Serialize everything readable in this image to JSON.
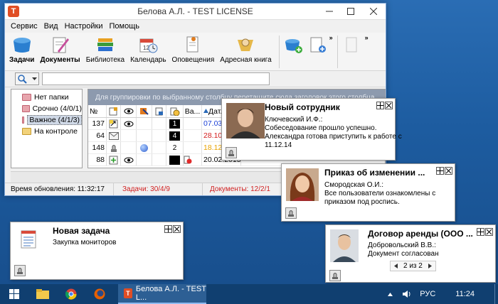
{
  "window": {
    "title": "Белова А.Л. - TEST LICENSE",
    "app_icon": "T",
    "controls": [
      "minimize-icon",
      "maximize-icon",
      "close-icon"
    ]
  },
  "menu": [
    "Сервис",
    "Вид",
    "Настройки",
    "Помощь"
  ],
  "toolbar": {
    "buttons": [
      {
        "label": "Задачи",
        "icon": "tasks-icon"
      },
      {
        "label": "Документы",
        "icon": "documents-icon"
      },
      {
        "label": "Библиотека",
        "icon": "library-icon"
      },
      {
        "label": "Календарь",
        "icon": "calendar-icon"
      },
      {
        "label": "Оповещения",
        "icon": "notifications-icon"
      },
      {
        "label": "Адресная книга",
        "icon": "address-book-icon"
      }
    ],
    "more": "»",
    "calendar_day": "12"
  },
  "search": {
    "value": "",
    "icon": "search-icon"
  },
  "folders": [
    {
      "label": "Нет папки",
      "color": "red"
    },
    {
      "label": "Срочно (4/0/1)",
      "color": "red"
    },
    {
      "label": "Важное (4/1/3)",
      "color": "red",
      "selected": true
    },
    {
      "label": "На контроле",
      "color": "yellow"
    }
  ],
  "grid": {
    "group_hint": "Для группировки по выбранному столбцу перетащите сюда заголовок этого столбца",
    "headers": {
      "num": "№",
      "v": "Ва...",
      "date": "Дат..."
    },
    "rows": [
      {
        "num": "137",
        "count": "1",
        "count_style": "black",
        "date": "07.03.2014",
        "date_color": "#1a3fd6",
        "eye": true
      },
      {
        "num": "64",
        "count": "4",
        "count_style": "black",
        "date": "28.10.2014",
        "date_color": "#d41c1c",
        "eye": false
      },
      {
        "num": "148",
        "count": "2",
        "count_style": "white",
        "date": "18.12.2014",
        "date_color": "#e8a200",
        "eye": false
      },
      {
        "num": "88",
        "count": "",
        "count_style": "black",
        "date": "20.02.2015",
        "date_color": "#000000",
        "eye": true
      }
    ]
  },
  "status": {
    "updated": "Время обновления: 11:32:17",
    "tasks": "Задачи: 30/4/9",
    "documents": "Документы: 12/2/1"
  },
  "notifications": [
    {
      "id": "new-employee",
      "title": "Новый сотрудник",
      "from": "Ключевский И.Ф.:",
      "lines": [
        "Собеседование прошло успешно.",
        "Александра готова приступить к работе с",
        "11.12.14"
      ]
    },
    {
      "id": "order-change",
      "title": "Приказ об изменении ...",
      "from": "Смородская О.И.:",
      "lines": [
        "Все пользователи ознакомлены с",
        "приказом под роспись."
      ]
    },
    {
      "id": "new-task",
      "title": "Новая задача",
      "from": "",
      "lines": [
        "Закупка мониторов"
      ]
    },
    {
      "id": "lease",
      "title": "Договор аренды (ООО ...",
      "from": "Добровольский В.В.:",
      "lines": [
        "Документ согласован"
      ],
      "pager": "2 из 2"
    }
  ],
  "taskbar": {
    "task_label": "Белова А.Л. - TEST L...",
    "lang": "РУС",
    "time": "11:24"
  }
}
